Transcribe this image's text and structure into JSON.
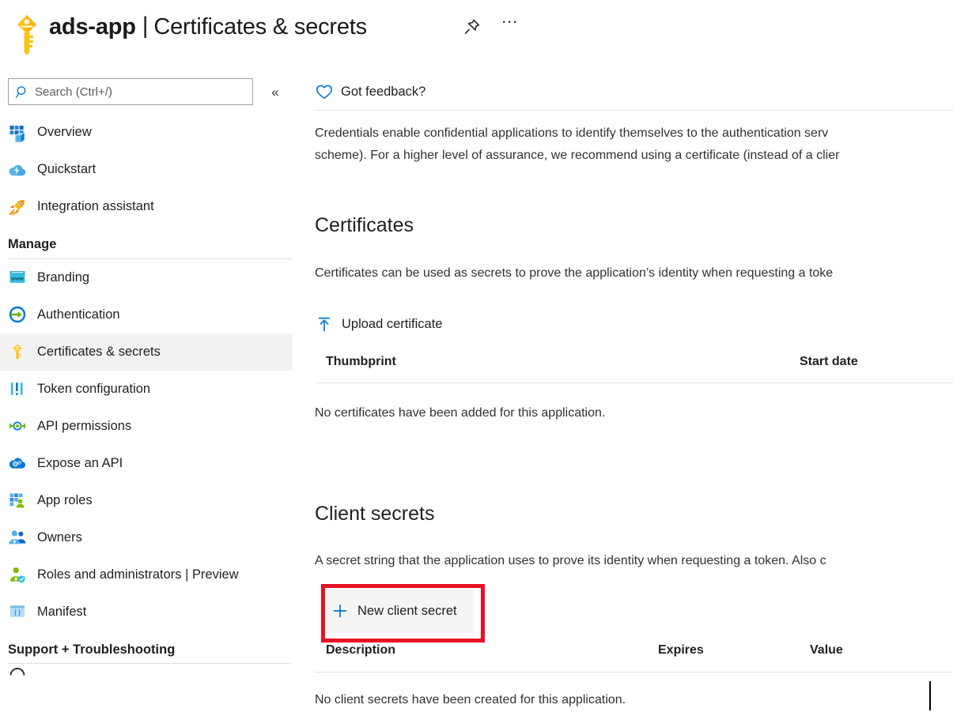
{
  "header": {
    "app_name": "ads-app",
    "separator": "|",
    "page_title": "Certificates & secrets",
    "pin_icon": "pin-icon",
    "more_icon": "ellipsis-icon",
    "key_icon": "key-icon"
  },
  "sidebar": {
    "search": {
      "placeholder": "Search (Ctrl+/)",
      "icon": "search-icon"
    },
    "collapse_label": "«",
    "top_items": [
      {
        "label": "Overview",
        "icon": "overview-grid-icon",
        "selected": false
      },
      {
        "label": "Quickstart",
        "icon": "cloud-lightning-icon",
        "selected": false
      },
      {
        "label": "Integration assistant",
        "icon": "rocket-icon",
        "selected": false
      }
    ],
    "groups": [
      {
        "title": "Manage",
        "items": [
          {
            "label": "Branding",
            "icon": "browser-www-icon",
            "selected": false
          },
          {
            "label": "Authentication",
            "icon": "arrow-in-circle-icon",
            "selected": false
          },
          {
            "label": "Certificates & secrets",
            "icon": "key-icon",
            "selected": true
          },
          {
            "label": "Token configuration",
            "icon": "bars-token-icon",
            "selected": false
          },
          {
            "label": "API permissions",
            "icon": "plug-connector-icon",
            "selected": false
          },
          {
            "label": "Expose an API",
            "icon": "cloud-gears-icon",
            "selected": false
          },
          {
            "label": "App roles",
            "icon": "grid-person-icon",
            "selected": false
          },
          {
            "label": "Owners",
            "icon": "two-people-icon",
            "selected": false
          },
          {
            "label": "Roles and administrators | Preview",
            "icon": "person-shield-icon",
            "selected": false
          },
          {
            "label": "Manifest",
            "icon": "braces-document-icon",
            "selected": false
          }
        ]
      },
      {
        "title": "Support + Troubleshooting",
        "items": []
      }
    ]
  },
  "main": {
    "feedback": {
      "label": "Got feedback?",
      "icon": "heart-icon"
    },
    "intro_text": "Credentials enable confidential applications to identify themselves to the authentication serv\nscheme). For a higher level of assurance, we recommend using a certificate (instead of a clier",
    "certificates": {
      "title": "Certificates",
      "description": "Certificates can be used as secrets to prove the application’s identity when requesting a toke",
      "upload_button": {
        "label": "Upload certificate",
        "icon": "upload-arrow-icon"
      },
      "columns": [
        "Thumbprint",
        "Start date"
      ],
      "empty_message": "No certificates have been added for this application."
    },
    "client_secrets": {
      "title": "Client secrets",
      "description": "A secret string that the application uses to prove its identity when requesting a token. Also c",
      "new_button": {
        "label": "New client secret",
        "icon": "plus-icon"
      },
      "columns": [
        "Description",
        "Expires",
        "Value"
      ],
      "empty_message": "No client secrets have been created for this application."
    }
  },
  "annotation": {
    "color": "#e81123",
    "target": "new-client-secret-button"
  }
}
